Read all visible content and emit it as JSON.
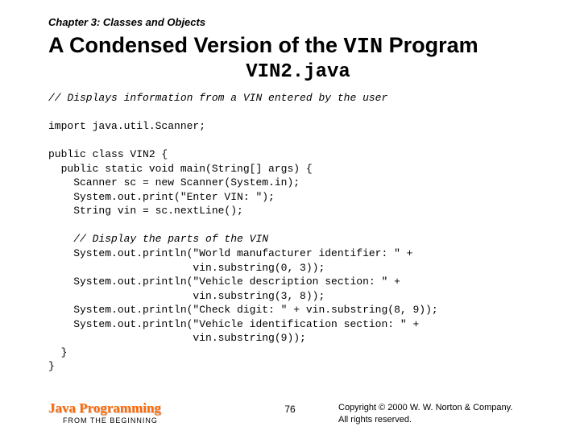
{
  "chapter": "Chapter 3: Classes and Objects",
  "title_pre": "A Condensed Version of the ",
  "title_mono": "VIN",
  "title_post": " Program",
  "subtitle": "VIN2.java",
  "code": {
    "c1": "// Displays information from a VIN entered by the user",
    "l2": "import java.util.Scanner;",
    "l3": "public class VIN2 {",
    "l4": "  public static void main(String[] args) {",
    "l5": "    Scanner sc = new Scanner(System.in);",
    "l6": "    System.out.print(\"Enter VIN: \");",
    "l7": "    String vin = sc.nextLine();",
    "c8": "    // Display the parts of the VIN",
    "l9": "    System.out.println(\"World manufacturer identifier: \" +",
    "l10": "                       vin.substring(0, 3));",
    "l11": "    System.out.println(\"Vehicle description section: \" +",
    "l12": "                       vin.substring(3, 8));",
    "l13": "    System.out.println(\"Check digit: \" + vin.substring(8, 9));",
    "l14": "    System.out.println(\"Vehicle identification section: \" +",
    "l15": "                       vin.substring(9));",
    "l16": "  }",
    "l17": "}"
  },
  "footer": {
    "brand": "Java Programming",
    "brand_sub": "FROM THE BEGINNING",
    "page": "76",
    "copy1": "Copyright © 2000 W. W. Norton & Company.",
    "copy2": "All rights reserved."
  }
}
